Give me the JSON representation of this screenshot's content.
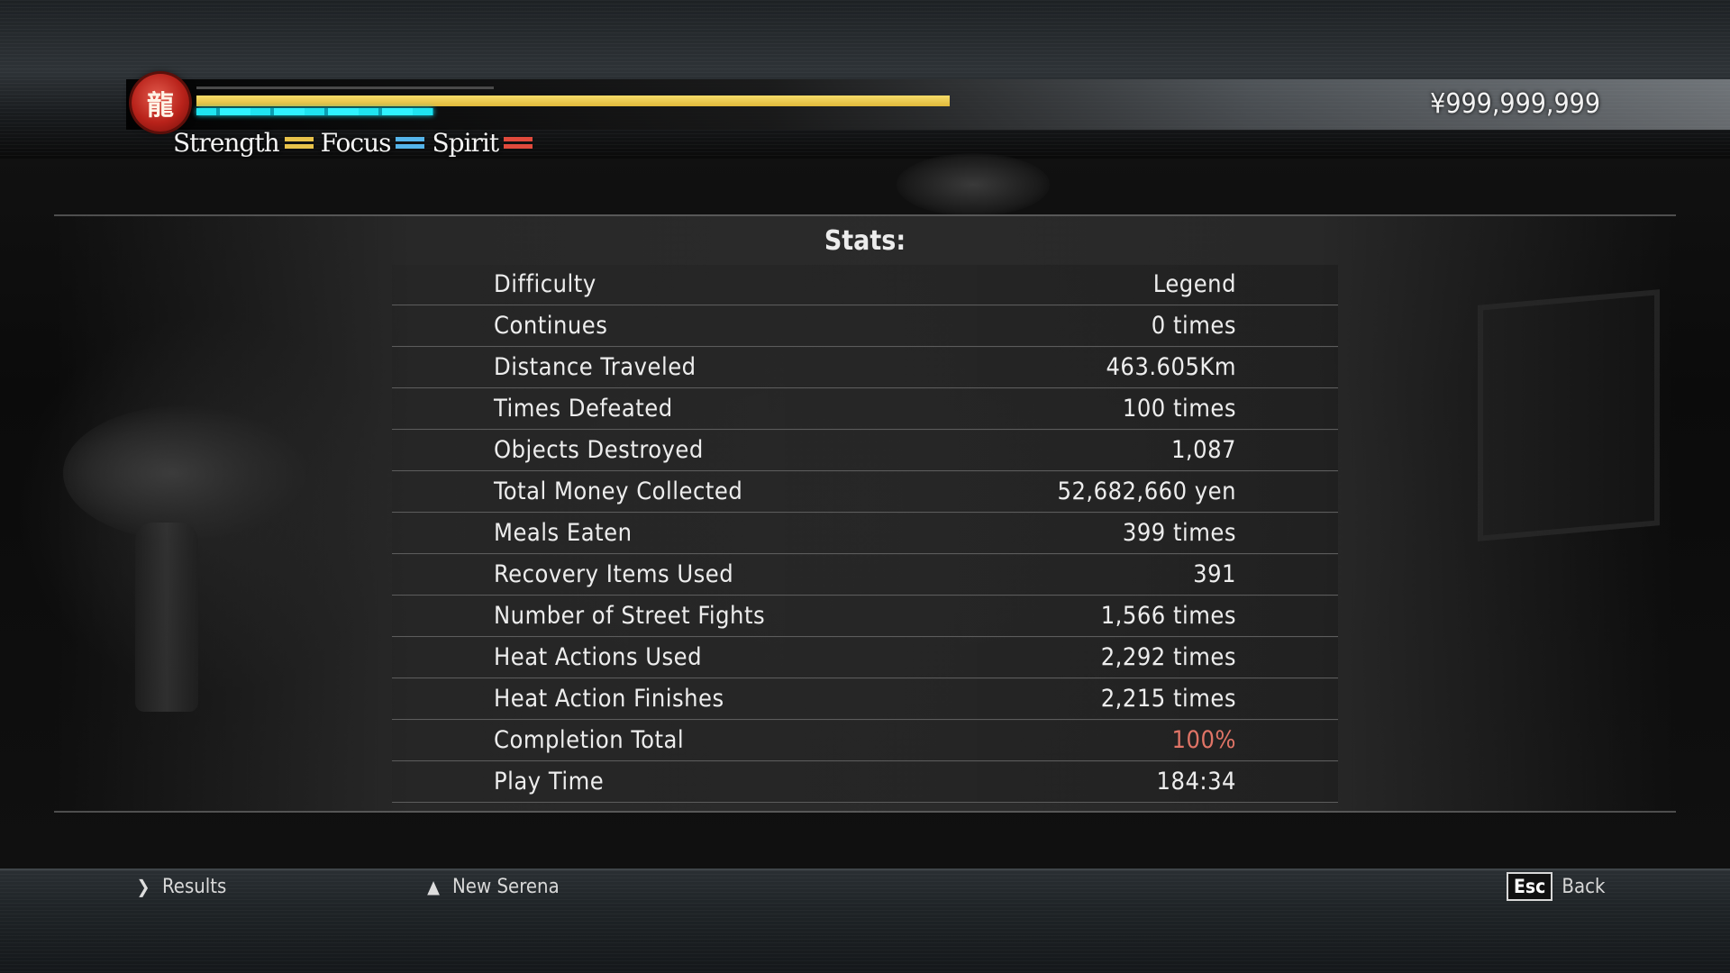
{
  "hud": {
    "emblem_glyph": "龍",
    "money": "¥999,999,999",
    "legend": {
      "strength": "Strength",
      "focus": "Focus",
      "spirit": "Spirit"
    },
    "health_fraction": 1.0,
    "heat_fraction": 0.56,
    "colors": {
      "health": "#e9c443",
      "heat": "#1fe4f0",
      "strength": "#e8c24a",
      "focus": "#55b4ea",
      "spirit": "#e04a3c",
      "highlight_value": "#e07466"
    }
  },
  "stats": {
    "title": "Stats:",
    "rows": [
      {
        "label": "Difficulty",
        "value": "Legend"
      },
      {
        "label": "Continues",
        "value": "0 times"
      },
      {
        "label": "Distance Traveled",
        "value": "463.605Km"
      },
      {
        "label": "Times Defeated",
        "value": "100 times"
      },
      {
        "label": "Objects Destroyed",
        "value": "1,087"
      },
      {
        "label": "Total Money Collected",
        "value": "52,682,660 yen"
      },
      {
        "label": "Meals Eaten",
        "value": "399 times"
      },
      {
        "label": "Recovery Items Used",
        "value": "391"
      },
      {
        "label": "Number of Street Fights",
        "value": "1,566 times"
      },
      {
        "label": "Heat Actions Used",
        "value": "2,292 times"
      },
      {
        "label": "Heat Action Finishes",
        "value": "2,215 times"
      },
      {
        "label": "Completion Total",
        "value": "100%"
      },
      {
        "label": "Play Time",
        "value": "184:34"
      }
    ]
  },
  "footer": {
    "results": {
      "icon": "right-bracket-icon",
      "glyph": "❯",
      "label": "Results"
    },
    "new_serena": {
      "icon": "up-arrow-icon",
      "glyph": "▲",
      "label": "New Serena"
    },
    "back": {
      "key": "Esc",
      "label": "Back"
    }
  }
}
